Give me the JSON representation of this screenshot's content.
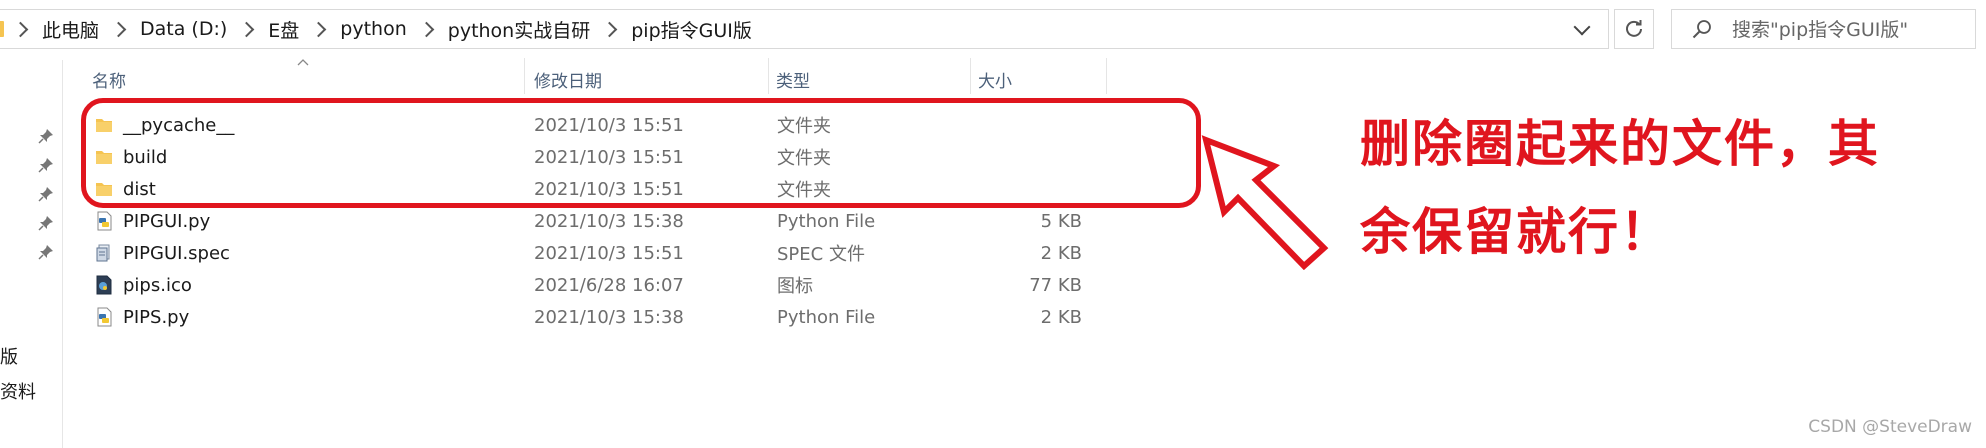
{
  "breadcrumbs": [
    "此电脑",
    "Data (D:)",
    "E盘",
    "python",
    "python实战自研",
    "pip指令GUI版"
  ],
  "search": {
    "placeholder": "搜索\"pip指令GUI版\""
  },
  "nav_items": [
    "版",
    "资料"
  ],
  "columns": {
    "name": "名称",
    "date": "修改日期",
    "type": "类型",
    "size": "大小"
  },
  "files": [
    {
      "name": "__pycache__",
      "date": "2021/10/3 15:51",
      "type": "文件夹",
      "size": "",
      "icon": "folder-icon"
    },
    {
      "name": "build",
      "date": "2021/10/3 15:51",
      "type": "文件夹",
      "size": "",
      "icon": "folder-icon"
    },
    {
      "name": "dist",
      "date": "2021/10/3 15:51",
      "type": "文件夹",
      "size": "",
      "icon": "folder-icon"
    },
    {
      "name": "PIPGUI.py",
      "date": "2021/10/3 15:38",
      "type": "Python File",
      "size": "5 KB",
      "icon": "python-file-icon"
    },
    {
      "name": "PIPGUI.spec",
      "date": "2021/10/3 15:51",
      "type": "SPEC 文件",
      "size": "2 KB",
      "icon": "spec-file-icon"
    },
    {
      "name": "pips.ico",
      "date": "2021/6/28 16:07",
      "type": "图标",
      "size": "77 KB",
      "icon": "ico-file-icon"
    },
    {
      "name": "PIPS.py",
      "date": "2021/10/3 15:38",
      "type": "Python File",
      "size": "2 KB",
      "icon": "python-file-icon"
    }
  ],
  "annotation": {
    "line1": "删除圈起来的文件，其",
    "line2": "余保留就行！"
  },
  "watermark": "CSDN @SteveDraw",
  "colors": {
    "annotation_red": "#e0151e",
    "folder_yellow": "#f5c451",
    "header_text": "#4c607a"
  }
}
